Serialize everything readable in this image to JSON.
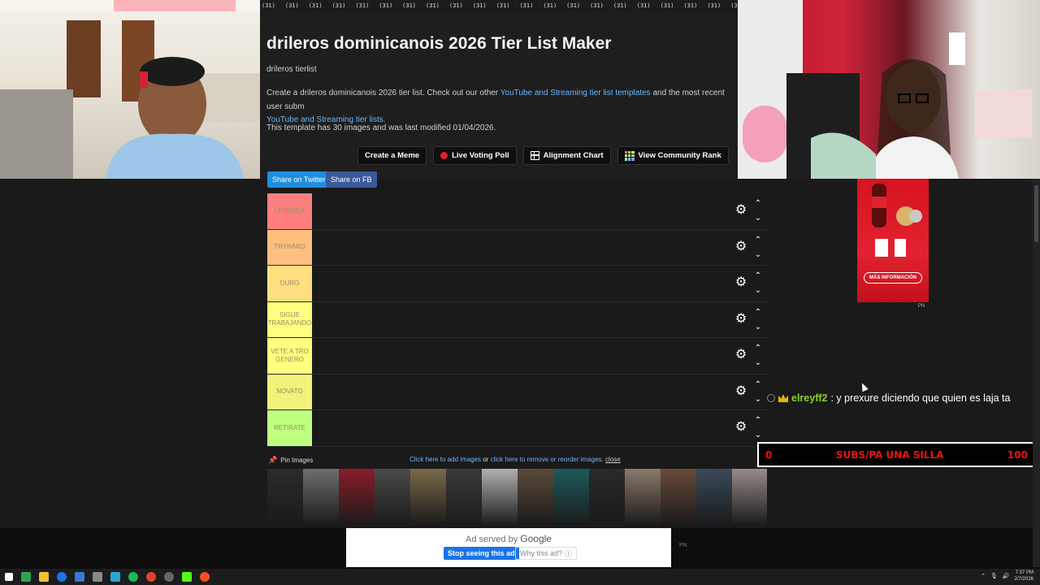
{
  "header": {
    "title": "drileros dominicanois 2026 Tier List Maker",
    "subtitle": "drileros tierlist",
    "desc_prefix": "Create a drileros dominicanois 2026 tier list. Check out our other ",
    "desc_link1": "YouTube and Streaming tier list templates",
    "desc_middle": " and the most recent user subm",
    "desc_link2": "YouTube and Streaming tier lists.",
    "meta": "This template has 30 images and was last modified 01/04/2026."
  },
  "strip_text": "(31)",
  "buttons": {
    "create_meme": "Create a Meme",
    "live_voting": "Live Voting Poll",
    "alignment": "Alignment Chart",
    "community": "View Community Rank"
  },
  "share": {
    "twitter": "Share on Twitter",
    "fb": "Share on FB"
  },
  "tiers": [
    {
      "label": "LEYENDA",
      "color": "#ff7f7f"
    },
    {
      "label": "TRYHARD",
      "color": "#ffbf7f"
    },
    {
      "label": "DURO",
      "color": "#ffdf7f"
    },
    {
      "label": "SIGUE TRABAJANDO",
      "color": "#ffff7f"
    },
    {
      "label": "VETE A TRO GENERO",
      "color": "#ffff7f"
    },
    {
      "label": "NOVATO",
      "color": "#f2f27a"
    },
    {
      "label": "RETIRATE",
      "color": "#bfff7f"
    }
  ],
  "bottom": {
    "pin": "Pin Images",
    "add_link": "Click here to add images",
    "or": " or ",
    "remove_link": "click here to remove or reorder images.",
    "close": "close"
  },
  "ad": {
    "served": "Ad served by ",
    "google": "Google",
    "stop": "Stop seeing this ad",
    "why": "Why this ad?",
    "pn": "PN"
  },
  "sidebar": {
    "coke_button": "MÁS INFORMACIÓN",
    "coke_pn": "PN"
  },
  "chat": {
    "user": "elreyff2",
    "message": ": y prexure diciendo que quien es laja ta"
  },
  "goal": {
    "current": "0",
    "label": "SUBS/PA UNA SILLA",
    "target": "100"
  },
  "clock": {
    "time": "7:37 PM",
    "date": "2/7/2026"
  },
  "colors": {
    "accent_link": "#6cb4ff",
    "twitter": "#1d8fe0",
    "facebook": "#3b5a9a",
    "goal_text": "#ee1111",
    "chat_user": "#8bd11a"
  }
}
